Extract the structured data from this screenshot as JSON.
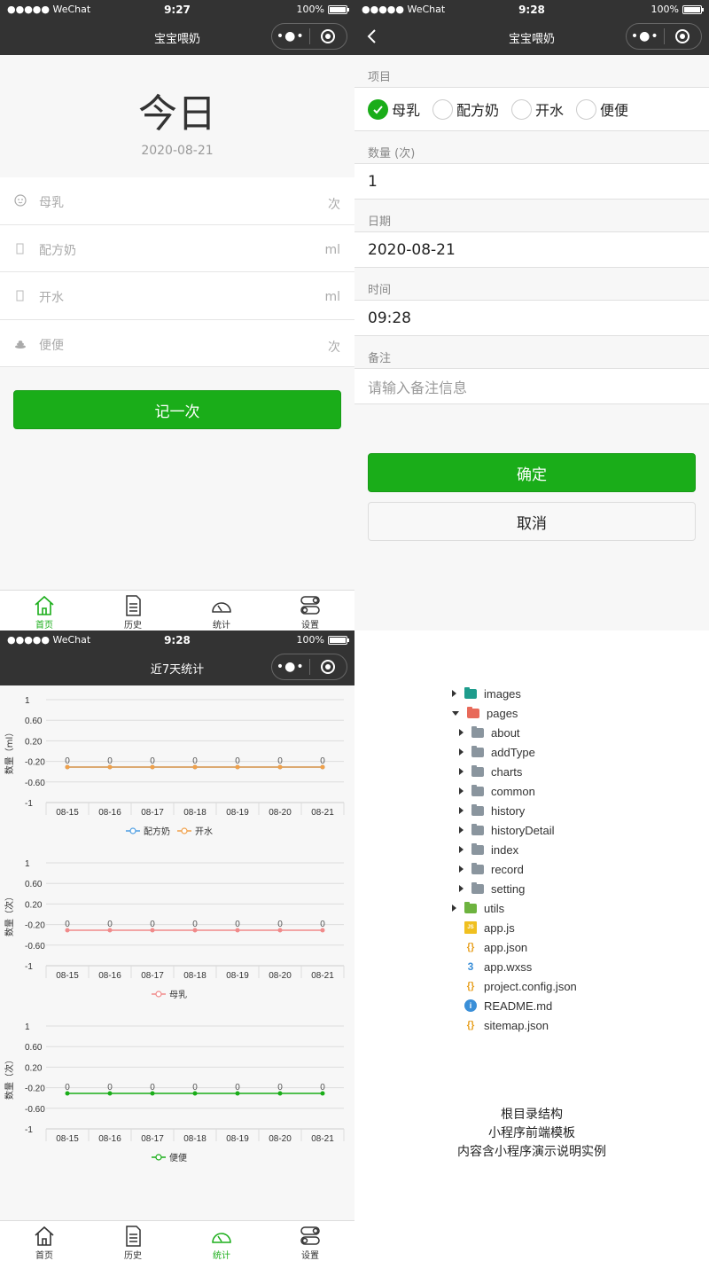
{
  "status": {
    "signal": "●●●●● WeChat",
    "battery": "100%"
  },
  "screen1": {
    "time": "9:27",
    "title": "宝宝喂奶",
    "today": "今日",
    "date": "2020-08-21",
    "items": [
      {
        "label": "母乳",
        "unit": "次",
        "icon": "baby-icon"
      },
      {
        "label": "配方奶",
        "unit": "ml",
        "icon": "bottle-icon"
      },
      {
        "label": "开水",
        "unit": "ml",
        "icon": "cup-icon"
      },
      {
        "label": "便便",
        "unit": "次",
        "icon": "poop-icon"
      }
    ],
    "record_button": "记一次"
  },
  "tabs": [
    {
      "label": "首页",
      "icon": "home-icon"
    },
    {
      "label": "历史",
      "icon": "history-icon"
    },
    {
      "label": "统计",
      "icon": "stats-icon"
    },
    {
      "label": "设置",
      "icon": "settings-icon"
    }
  ],
  "screen2": {
    "time": "9:28",
    "title": "宝宝喂奶",
    "project_label": "项目",
    "options": [
      "母乳",
      "配方奶",
      "开水",
      "便便"
    ],
    "selected": "母乳",
    "quantity_label": "数量 (次)",
    "quantity_value": "1",
    "date_label": "日期",
    "date_value": "2020-08-21",
    "time_label": "时间",
    "time_value": "09:28",
    "note_label": "备注",
    "note_placeholder": "请输入备注信息",
    "confirm": "确定",
    "cancel": "取消"
  },
  "screen3": {
    "time": "9:28",
    "title": "近7天统计"
  },
  "chart_data": [
    {
      "type": "line",
      "categories": [
        "08-15",
        "08-16",
        "08-17",
        "08-18",
        "08-19",
        "08-20",
        "08-21"
      ],
      "ylabel": "数量（ml）",
      "yticks": [
        "1",
        "0.60",
        "0.20",
        "-0.20",
        "-0.60",
        "-1"
      ],
      "series": [
        {
          "name": "配方奶",
          "values": [
            0,
            0,
            0,
            0,
            0,
            0,
            0
          ],
          "color": "#4e9ee2"
        },
        {
          "name": "开水",
          "values": [
            0,
            0,
            0,
            0,
            0,
            0,
            0
          ],
          "color": "#f0a04a"
        }
      ],
      "ylim": [
        -1,
        1
      ]
    },
    {
      "type": "line",
      "categories": [
        "08-15",
        "08-16",
        "08-17",
        "08-18",
        "08-19",
        "08-20",
        "08-21"
      ],
      "ylabel": "数量（次）",
      "yticks": [
        "1",
        "0.60",
        "0.20",
        "-0.20",
        "-0.60",
        "-1"
      ],
      "series": [
        {
          "name": "母乳",
          "values": [
            0,
            0,
            0,
            0,
            0,
            0,
            0
          ],
          "color": "#f08a8a"
        }
      ],
      "ylim": [
        -1,
        1
      ]
    },
    {
      "type": "line",
      "categories": [
        "08-15",
        "08-16",
        "08-17",
        "08-18",
        "08-19",
        "08-20",
        "08-21"
      ],
      "ylabel": "数量（次）",
      "yticks": [
        "1",
        "0.60",
        "0.20",
        "-0.20",
        "-0.60",
        "-1"
      ],
      "series": [
        {
          "name": "便便",
          "values": [
            0,
            0,
            0,
            0,
            0,
            0,
            0
          ],
          "color": "#1aad19"
        }
      ],
      "ylim": [
        -1,
        1
      ]
    }
  ],
  "tree": [
    {
      "name": "images",
      "kind": "folder",
      "color": "#1e9c8c",
      "arrow": "right",
      "level": 0
    },
    {
      "name": "pages",
      "kind": "folder",
      "color": "#e86a5a",
      "arrow": "down",
      "level": 0
    },
    {
      "name": "about",
      "kind": "folder",
      "color": "#8a959e",
      "arrow": "right",
      "level": 1
    },
    {
      "name": "addType",
      "kind": "folder",
      "color": "#8a959e",
      "arrow": "right",
      "level": 1
    },
    {
      "name": "charts",
      "kind": "folder",
      "color": "#8a959e",
      "arrow": "right",
      "level": 1
    },
    {
      "name": "common",
      "kind": "folder",
      "color": "#8a959e",
      "arrow": "right",
      "level": 1
    },
    {
      "name": "history",
      "kind": "folder",
      "color": "#8a959e",
      "arrow": "right",
      "level": 1
    },
    {
      "name": "historyDetail",
      "kind": "folder",
      "color": "#8a959e",
      "arrow": "right",
      "level": 1
    },
    {
      "name": "index",
      "kind": "folder",
      "color": "#8a959e",
      "arrow": "right",
      "level": 1
    },
    {
      "name": "record",
      "kind": "folder",
      "color": "#8a959e",
      "arrow": "right",
      "level": 1
    },
    {
      "name": "setting",
      "kind": "folder",
      "color": "#8a959e",
      "arrow": "right",
      "level": 1
    },
    {
      "name": "utils",
      "kind": "folder",
      "color": "#6db33f",
      "arrow": "right",
      "level": 0
    },
    {
      "name": "app.js",
      "kind": "js",
      "color": "#f0c020",
      "level": 0
    },
    {
      "name": "app.json",
      "kind": "json",
      "color": "#e8a020",
      "level": 0
    },
    {
      "name": "app.wxss",
      "kind": "css",
      "color": "#3a8fd8",
      "level": 0
    },
    {
      "name": "project.config.json",
      "kind": "json",
      "color": "#e8a020",
      "level": 0
    },
    {
      "name": "README.md",
      "kind": "info",
      "color": "#3a8fd8",
      "level": 0
    },
    {
      "name": "sitemap.json",
      "kind": "json",
      "color": "#e8a020",
      "level": 0
    }
  ],
  "caption": [
    "根目录结构",
    "小程序前端模板",
    "内容含小程序演示说明实例"
  ]
}
